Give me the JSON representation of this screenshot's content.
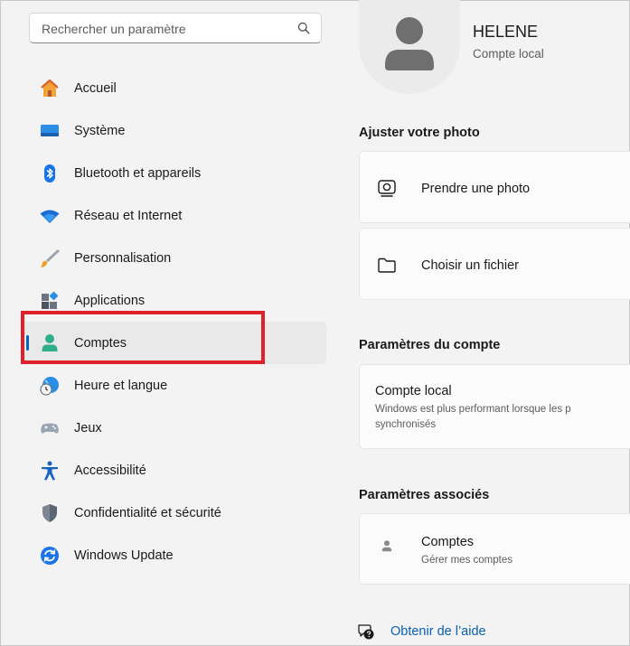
{
  "search": {
    "placeholder": "Rechercher un paramètre",
    "icon": "search-icon"
  },
  "nav": {
    "items": [
      {
        "label": "Accueil",
        "icon": "home-icon"
      },
      {
        "label": "Système",
        "icon": "display-icon"
      },
      {
        "label": "Bluetooth et appareils",
        "icon": "bluetooth-icon"
      },
      {
        "label": "Réseau et Internet",
        "icon": "wifi-icon"
      },
      {
        "label": "Personnalisation",
        "icon": "brush-icon"
      },
      {
        "label": "Applications",
        "icon": "apps-icon"
      },
      {
        "label": "Comptes",
        "icon": "person-icon",
        "active": true
      },
      {
        "label": "Heure et langue",
        "icon": "globe-clock-icon"
      },
      {
        "label": "Jeux",
        "icon": "gamepad-icon"
      },
      {
        "label": "Accessibilité",
        "icon": "accessibility-icon"
      },
      {
        "label": "Confidentialité et sécurité",
        "icon": "shield-icon"
      },
      {
        "label": "Windows Update",
        "icon": "update-icon"
      }
    ]
  },
  "user": {
    "name": "HELENE",
    "account_type": "Compte local"
  },
  "photo": {
    "title": "Ajuster votre photo",
    "take_photo": "Prendre une photo",
    "choose_file": "Choisir un fichier"
  },
  "account_settings": {
    "title": "Paramètres du compte",
    "local_title": "Compte local",
    "local_desc_line1": "Windows est plus performant lorsque les p",
    "local_desc_line2": "synchronisés"
  },
  "related": {
    "title": "Paramètres associés",
    "accounts_title": "Comptes",
    "accounts_desc": "Gérer mes comptes"
  },
  "help": {
    "label": "Obtenir de l’aide"
  },
  "colors": {
    "accent": "#0067c0",
    "highlight": "#e0202a",
    "link": "#0a5fb4"
  }
}
